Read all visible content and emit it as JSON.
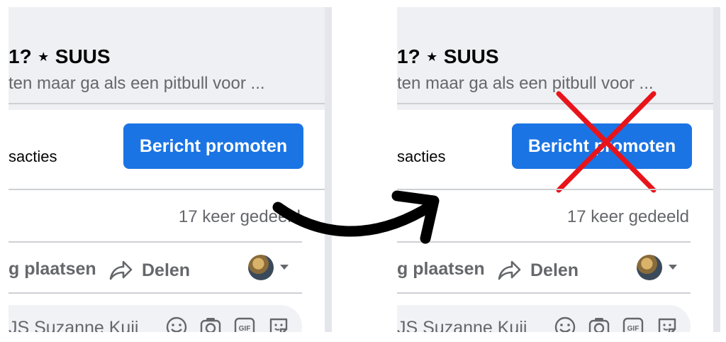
{
  "panels": [
    {
      "id": "before",
      "title": "1? ⋆ SUUS",
      "subtitle": "ten maar ga als een pitbull voor ...",
      "row_label": "sacties",
      "promote_button": "Bericht promoten",
      "shares": "17 keer gedeeld",
      "comment_action": "g plaatsen",
      "share_action": "Delen",
      "comment_placeholder": "JS Suzanne Kuij",
      "crossed_out": false
    },
    {
      "id": "after",
      "title": "1? ⋆ SUUS",
      "subtitle": "ten maar ga als een pitbull voor ...",
      "row_label": "sacties",
      "promote_button": "Bericht promoten",
      "shares": "17 keer gedeeld",
      "comment_action": "g plaatsen",
      "share_action": "Delen",
      "comment_placeholder": "JS Suzanne Kuij",
      "crossed_out": true
    }
  ],
  "icons": {
    "share": "share-arrow-icon",
    "caret": "caret-down-icon",
    "comment_tools": [
      "emoji-icon",
      "camera-icon",
      "gif-icon",
      "sticker-icon"
    ],
    "transition": "curved-arrow-icon",
    "cross": "red-cross-icon"
  },
  "colors": {
    "accent": "#1b74e4",
    "cross": "#e8141a",
    "secondary_text": "#65676b"
  }
}
